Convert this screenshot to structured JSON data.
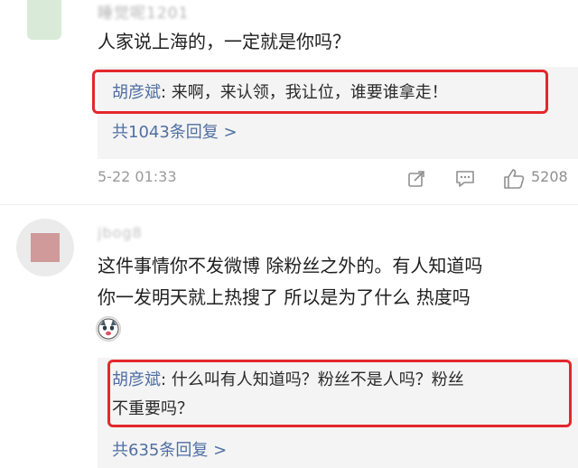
{
  "comments": [
    {
      "name_blurred": "睡觉呢1201",
      "text": "人家说上海的，一定就是你吗？",
      "reply": {
        "author": "胡彦斌",
        "text": ": 来啊，来认领，我让位，谁要谁拿走！"
      },
      "reply_count": "共1043条回复 >",
      "time": "5-22 01:33",
      "likes": "5208"
    },
    {
      "name_blurred": "jbog8",
      "text_lines": [
        "这件事情你不发微博 除粉丝之外的。有人知道吗",
        "你一发明天就上热搜了 所以是为了什么 热度吗"
      ],
      "reply": {
        "author": "胡彦斌",
        "text_line1": ": 什么叫有人知道吗？粉丝不是人吗？粉丝",
        "text_line2": "不重要吗？"
      },
      "reply_count": "共635条回复 >"
    }
  ],
  "icons": {
    "share": "share-icon",
    "comment": "comment-icon",
    "like": "thumbs-up-icon",
    "emoji": "husky-emoji-icon"
  },
  "colors": {
    "link_blue": "#4f6fa3",
    "highlight_red": "#e3282c",
    "reply_bg": "#f4f4f4",
    "meta_gray": "#9a9a9a"
  }
}
